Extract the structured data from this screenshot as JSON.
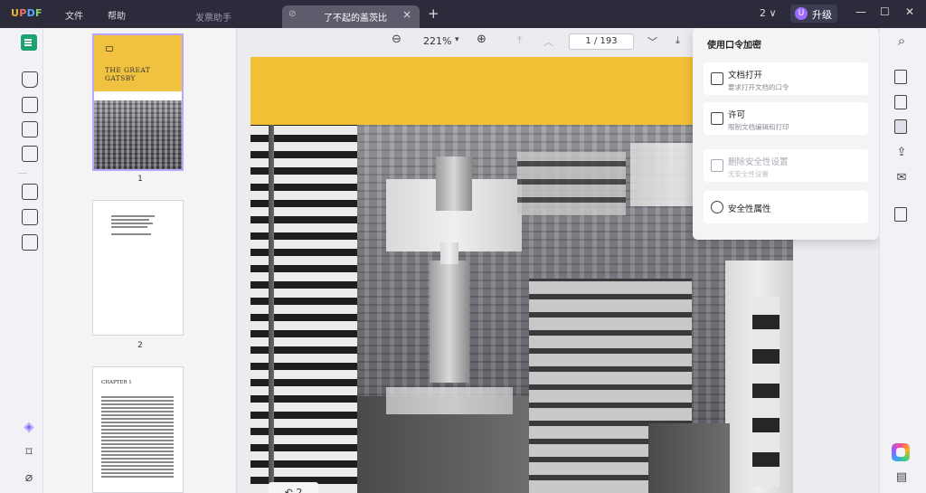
{
  "app": {
    "logo": {
      "u": "U",
      "p": "P",
      "d": "D",
      "f": "F"
    },
    "menu": {
      "file": "文件",
      "help": "帮助"
    },
    "tabs": [
      {
        "label": "发票助手",
        "active": false
      },
      {
        "label": "了不起的盖茨比",
        "active": true
      }
    ],
    "tab_add": "+",
    "tab_close": "×",
    "window_count": "2 ∨",
    "upgrade": {
      "avatar": "U",
      "label": "升级"
    },
    "window_buttons": {
      "minimize": "—",
      "maximize": "☐",
      "close": "✕"
    }
  },
  "thumbnails": {
    "pages": [
      {
        "number": "1",
        "selected": true,
        "title": "THE GREAT GATSBY"
      },
      {
        "number": "2",
        "selected": false
      },
      {
        "number": "",
        "selected": false,
        "heading": "CHAPTER 1"
      }
    ]
  },
  "toolbar": {
    "zoom_out": "⊖",
    "zoom_value": "221%",
    "zoom_dropdown": "▾",
    "zoom_in": "⊕",
    "first_page": "⤒",
    "prev_page": "︿",
    "page_indicator": "1  /  193",
    "next_page": "﹀",
    "last_page": "⤓"
  },
  "viewer": {
    "page_back_label": "↶  2"
  },
  "security_popup": {
    "title": "使用口令加密",
    "items": [
      {
        "title": "文档打开",
        "subtitle": "要求打开文档的口令",
        "enabled": true
      },
      {
        "title": "许可",
        "subtitle": "限制文档编辑和打印",
        "enabled": true
      },
      {
        "title": "删除安全性设置",
        "subtitle": "无安全性设置",
        "enabled": false
      },
      {
        "title": "安全性属性",
        "subtitle": "",
        "enabled": true
      }
    ]
  },
  "right_rail": {
    "search_icon": "⌕",
    "share_icon": "⇪",
    "mail_icon": "✉",
    "comment_icon": "▤"
  },
  "colors": {
    "accent": "#1aa36f",
    "titlebar": "#2b2b3b",
    "cover_yellow": "#f2c035",
    "upgrade_avatar": "#9b6bff"
  }
}
